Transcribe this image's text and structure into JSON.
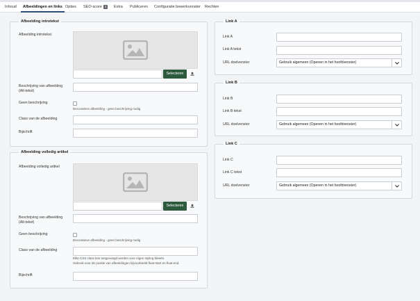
{
  "tabs": [
    {
      "label": "Inhoud"
    },
    {
      "label": "Afbeeldingen en links"
    },
    {
      "label": "Opties"
    },
    {
      "label": "SEO-score",
      "badge": "0"
    },
    {
      "label": "Extra"
    },
    {
      "label": "Publiceren"
    },
    {
      "label": "Configuratie bewerkvenster"
    },
    {
      "label": "Rechten"
    }
  ],
  "intro_image": {
    "legend": "Afbeelding introtekst",
    "image_label": "Afbeelding introtekst",
    "select_button": "Selecteren",
    "alt_label_1": "Beschrijving van afbeelding",
    "alt_label_2": "(Alt-tekst)",
    "no_desc_label": "Geen beschrijving",
    "no_desc_hint": "Decoratieve afbeelding - geen beschrijving nodig",
    "class_label": "Class van de afbeelding",
    "caption_label": "Bijschrift"
  },
  "full_image": {
    "legend": "Afbeelding volledig artikel",
    "image_label": "Afbeelding volledig artikel",
    "select_button": "Selecteren",
    "alt_label_1": "Beschrijving van afbeelding",
    "alt_label_2": "(Alt-tekst)",
    "no_desc_label": "Geen beschrijving",
    "no_desc_hint": "Decoratieve afbeelding - geen beschrijving nodig",
    "class_label": "Class van de afbeelding",
    "class_hint_1": "Elke CSS class kan toegevoegd worden voor eigen styling bleeën.",
    "class_hint_2": "Gebruik voor de positie van afbeeldingen bijvoorbeeld float-start en float-end.",
    "caption_label": "Bijschrift"
  },
  "link_a": {
    "legend": "Link A",
    "link_label": "Link A",
    "text_label": "Link A tekst",
    "target_label": "URL doelvenster",
    "target_value": "Gebruik algemeen (Openen in het hoofdvenster)"
  },
  "link_b": {
    "legend": "Link B",
    "link_label": "Link B",
    "text_label": "Link B tekst",
    "target_label": "URL doelvenster",
    "target_value": "Gebruik algemeen (Openen in het hoofdvenster)"
  },
  "link_c": {
    "legend": "Link C",
    "link_label": "Link C",
    "text_label": "Link C tekst",
    "target_label": "URL doelvenster",
    "target_value": "Gebruik algemeen (Openen in het hoofdvenster)"
  },
  "colors": {
    "accent": "#2f4f7a",
    "button": "#2d5a3d",
    "background": "#f3f4f6"
  }
}
